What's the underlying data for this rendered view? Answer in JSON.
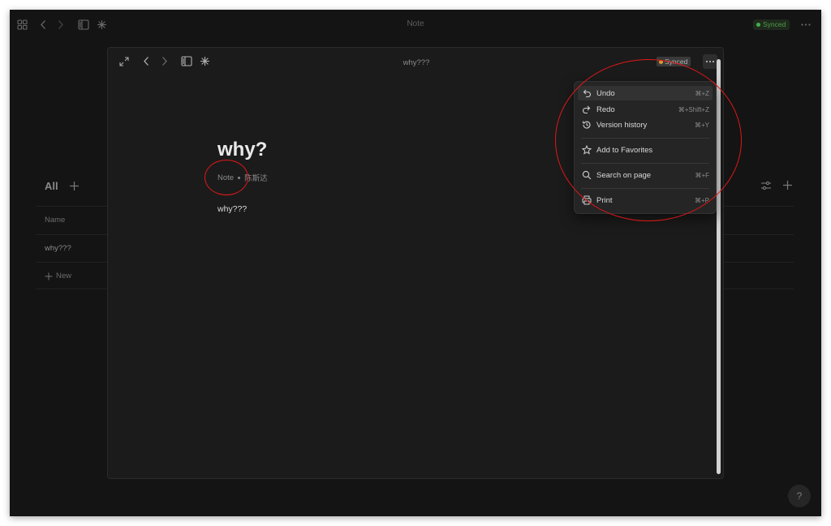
{
  "background_app": {
    "title": "Note",
    "sync_status": "Synced",
    "list_header": "All",
    "table": {
      "column_name": "Name",
      "rows": [
        "why???"
      ],
      "new_label": "New"
    },
    "help_label": "?"
  },
  "modal": {
    "title": "why???",
    "sync_status": "Synced",
    "document": {
      "title": "why?",
      "type": "Note",
      "author": "陈斯达",
      "body": "why???"
    }
  },
  "more_menu": {
    "items": [
      {
        "label": "Undo",
        "shortcut": "⌘+Z",
        "icon": "undo-icon"
      },
      {
        "label": "Redo",
        "shortcut": "⌘+Shift+Z",
        "icon": "redo-icon"
      },
      {
        "label": "Version history",
        "shortcut": "⌘+Y",
        "icon": "history-icon"
      },
      {
        "label": "Add to Favorites",
        "shortcut": "",
        "icon": "star-icon"
      },
      {
        "label": "Search on page",
        "shortcut": "⌘+F",
        "icon": "search-icon"
      },
      {
        "label": "Print",
        "shortcut": "⌘+P",
        "icon": "printer-icon"
      }
    ]
  },
  "colors": {
    "app_background": "#141414",
    "modal_background": "#1b1b1b",
    "menu_background": "#252525",
    "annotation_red": "#e01818",
    "synced_green": "#43b04b",
    "synced_orange": "#d89c2b"
  }
}
